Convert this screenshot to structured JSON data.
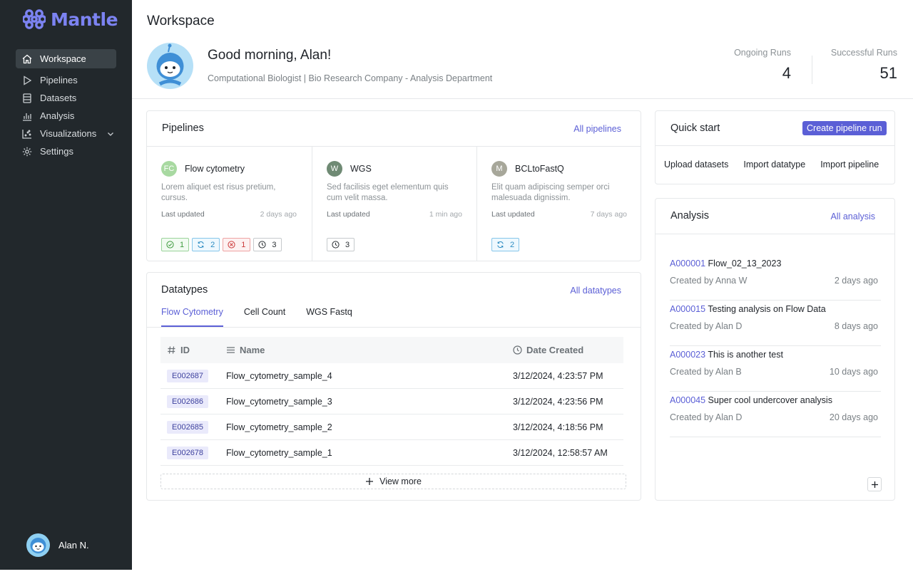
{
  "app": {
    "logo_text": "Mantle"
  },
  "sidebar": {
    "items": [
      {
        "label": "Workspace",
        "icon": "home-icon"
      },
      {
        "label": "Pipelines",
        "icon": "play-icon"
      },
      {
        "label": "Datasets",
        "icon": "database-icon"
      },
      {
        "label": "Analysis",
        "icon": "bar-chart-icon"
      },
      {
        "label": "Visualizations",
        "icon": "scatter-chart-icon"
      },
      {
        "label": "Settings",
        "icon": "gear-icon"
      }
    ],
    "user_name": "Alan N."
  },
  "header": {
    "page_title": "Workspace",
    "greeting": "Good morning, Alan!",
    "subtitle": "Computational Biologist | Bio Research Company - Analysis Department",
    "stats": [
      {
        "label": "Ongoing Runs",
        "value": "4"
      },
      {
        "label": "Successful Runs",
        "value": "51"
      }
    ]
  },
  "pipelines": {
    "title": "Pipelines",
    "link": "All pipelines",
    "items": [
      {
        "initials": "FC",
        "badge_color": "#a8d9a1",
        "name": "Flow cytometry",
        "desc": "Lorem aliquet est risus pretium, cursus.",
        "meta_label": "Last updated",
        "updated": "2 days ago",
        "stats": {
          "ok": "1",
          "running": "2",
          "failed": "1",
          "waiting": "3"
        }
      },
      {
        "initials": "W",
        "badge_color": "#6f8a74",
        "name": "WGS",
        "desc": "Sed facilisis eget elementum quis cum velit massa.",
        "meta_label": "Last updated",
        "updated": "1 min ago",
        "stats": {
          "waiting": "3"
        }
      },
      {
        "initials": "M",
        "badge_color": "#a7a79a",
        "name": "BCLtoFastQ",
        "desc": "Elit quam adipiscing semper orci malesuada dignissim.",
        "meta_label": "Last updated",
        "updated": "7 days ago",
        "stats": {
          "running": "2"
        }
      }
    ]
  },
  "datatypes": {
    "title": "Datatypes",
    "link": "All datatypes",
    "tabs": [
      "Flow Cytometry",
      "Cell Count",
      "WGS Fastq"
    ],
    "columns": [
      "ID",
      "Name",
      "Date Created"
    ],
    "rows": [
      {
        "id": "E002687",
        "name": "Flow_cytometry_sample_4",
        "date": "3/12/2024, 4:23:57 PM"
      },
      {
        "id": "E002686",
        "name": "Flow_cytometry_sample_3",
        "date": "3/12/2024, 4:23:56 PM"
      },
      {
        "id": "E002685",
        "name": "Flow_cytometry_sample_2",
        "date": "3/12/2024, 4:18:56 PM"
      },
      {
        "id": "E002678",
        "name": "Flow_cytometry_sample_1",
        "date": "3/12/2024, 12:58:57 AM"
      }
    ],
    "view_more": "View more"
  },
  "quick_start": {
    "title": "Quick start",
    "button": "Create pipeline run",
    "actions": [
      "Upload datasets",
      "Import datatype",
      "Import pipeline"
    ]
  },
  "analysis": {
    "title": "Analysis",
    "link": "All analysis",
    "items": [
      {
        "id": "A000001",
        "name": "Flow_02_13_2023",
        "by": "Created by Anna W",
        "time": "2 days ago"
      },
      {
        "id": "A000015",
        "name": "Testing analysis on Flow Data",
        "by": "Created by Alan D",
        "time": "8 days ago"
      },
      {
        "id": "A000023",
        "name": "This is another test",
        "by": "Created by Alan B",
        "time": "10 days ago"
      },
      {
        "id": "A000045",
        "name": "Super cool undercover analysis",
        "by": "Created by Alan D",
        "time": "20 days ago"
      }
    ]
  },
  "colors": {
    "accent": "#5b5fd6",
    "sidebar_bg": "#22282c"
  }
}
